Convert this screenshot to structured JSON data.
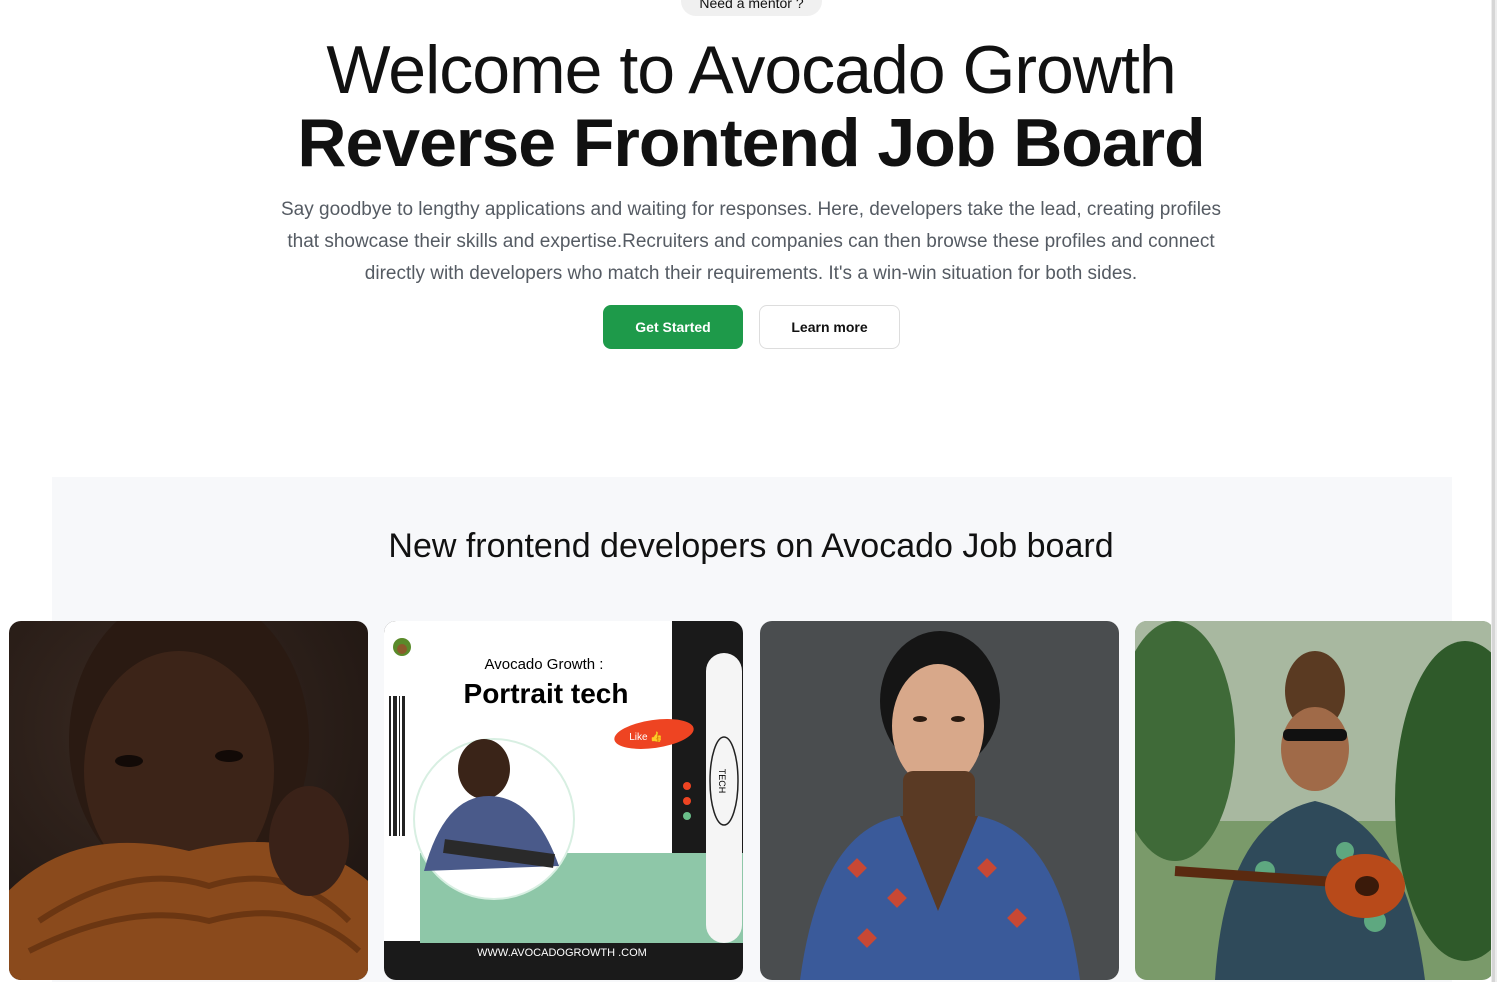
{
  "badge": {
    "label": "Need a mentor ?"
  },
  "hero": {
    "title_line1": "Welcome to Avocado Growth",
    "title_line2": "Reverse Frontend Job Board",
    "description": "Say goodbye to lengthy applications and waiting for responses. Here, developers take the lead, creating profiles that showcase their skills and expertise.Recruiters and companies can then browse these profiles and connect directly with developers who match their requirements. It's a win-win situation for both sides.",
    "primary_button": "Get Started",
    "secondary_button": "Learn more"
  },
  "developers_section": {
    "title": "New frontend developers on Avocado Job board",
    "cards": [
      {
        "image": "portrait-man-turtleneck"
      },
      {
        "image": "avocado-growth-portrait-tech-poster",
        "poster_heading": "Avocado Growth :",
        "poster_title": "Portrait tech",
        "poster_like": "Like 👍",
        "poster_tag": "TECH",
        "poster_url": "WWW.AVOCADOGROWTH .COM"
      },
      {
        "image": "portrait-woman-patterned-shirt"
      },
      {
        "image": "portrait-man-ukulele"
      }
    ]
  },
  "colors": {
    "primary": "#1e9a4a",
    "section_bg": "#f7f8fa",
    "text_muted": "#555b63"
  }
}
